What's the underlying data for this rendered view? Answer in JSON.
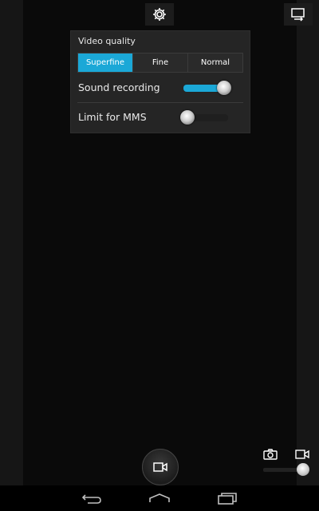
{
  "popup": {
    "video_quality_label": "Video quality",
    "quality_options": [
      "Superfine",
      "Fine",
      "Normal"
    ],
    "selected_quality": "Superfine",
    "sound_recording_label": "Sound recording",
    "sound_recording_on": true,
    "limit_mms_label": "Limit for MMS",
    "limit_mms_on": false
  },
  "icons": {
    "settings": "gear-icon",
    "switch_camera": "switch-camera-icon",
    "shutter": "video-camera-icon",
    "mode_photo": "camera-icon",
    "mode_video": "video-camera-icon",
    "nav_back": "back-icon",
    "nav_home": "home-icon",
    "nav_recents": "recents-icon"
  },
  "mode_switch": {
    "selected": "video"
  },
  "colors": {
    "accent": "#1ba8d7"
  }
}
